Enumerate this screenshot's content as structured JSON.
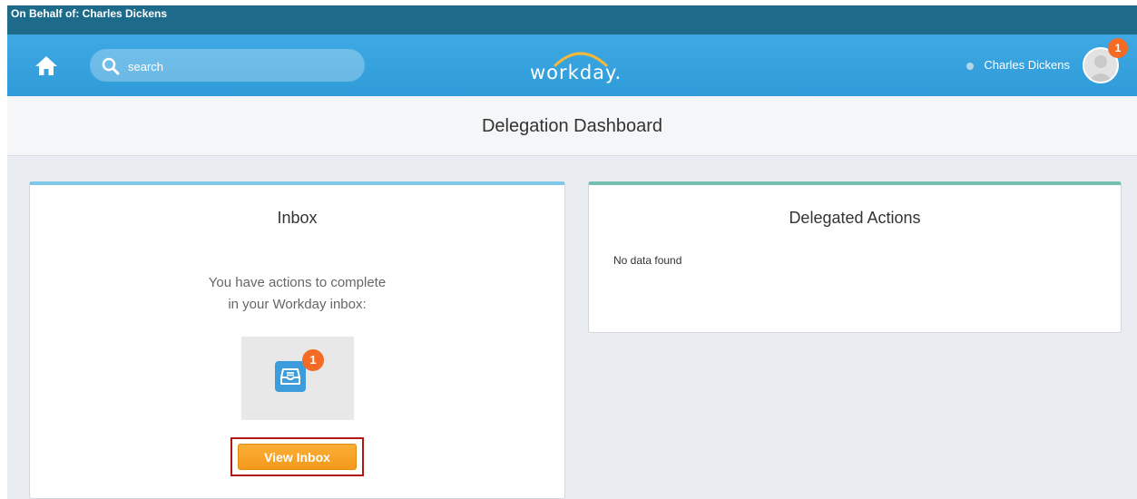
{
  "behalf_bar": {
    "text": "On Behalf of: Charles Dickens"
  },
  "header": {
    "home_icon": "home-icon",
    "search": {
      "icon": "search-icon",
      "placeholder": "search",
      "value": ""
    },
    "logo": {
      "text": "workday."
    },
    "user": {
      "name": "Charles Dickens",
      "notification_count": "1",
      "avatar_icon": "avatar-icon"
    }
  },
  "page": {
    "title": "Delegation Dashboard"
  },
  "inbox_card": {
    "title": "Inbox",
    "message_line1": "You have actions to complete",
    "message_line2": "in your Workday inbox:",
    "icon": "inbox-tray-icon",
    "badge_count": "1",
    "button_label": "View Inbox"
  },
  "actions_card": {
    "title": "Delegated Actions",
    "empty_text": "No data found"
  },
  "colors": {
    "behalf_bar": "#1e6a8a",
    "header": "#3ea9e4",
    "badge": "#f36b24",
    "button": "#f7a52a",
    "highlight": "#b01818",
    "inbox_card_accent": "#7fc8e8",
    "actions_card_accent": "#74c0b0"
  }
}
